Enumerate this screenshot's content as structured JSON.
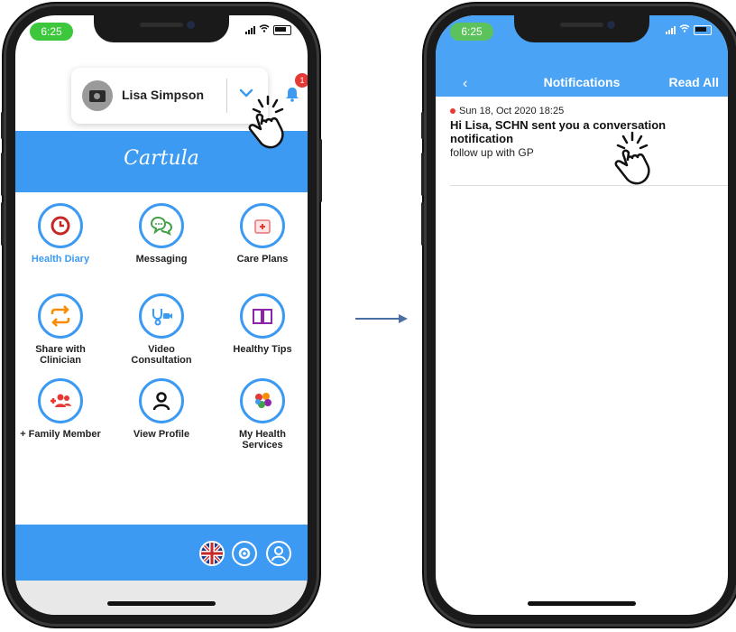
{
  "status": {
    "time": "6:25"
  },
  "home": {
    "user_name": "Lisa Simpson",
    "notification_count": "1",
    "brand": "Cartula",
    "tiles": [
      {
        "label": "Health Diary",
        "icon": "clock-icon",
        "color": "#c62828",
        "active": true
      },
      {
        "label": "Messaging",
        "icon": "chat-bubbles-icon",
        "color": "#43a047"
      },
      {
        "label": "Care Plans",
        "icon": "care-plan-icon",
        "color": "#e53935"
      },
      {
        "label": "Share with Clinician",
        "icon": "swap-arrows-icon",
        "color": "#fb8c00"
      },
      {
        "label": "Video Consultation",
        "icon": "stethoscope-video-icon",
        "color": "#3c9af2"
      },
      {
        "label": "Healthy Tips",
        "icon": "book-icon",
        "color": "#8e24aa"
      },
      {
        "label": "+ Family Member",
        "icon": "add-family-icon",
        "color": "#e53935"
      },
      {
        "label": "View Profile",
        "icon": "person-icon",
        "color": "#222222"
      },
      {
        "label": "My Health Services",
        "icon": "services-logo-icon",
        "color": "#3c9af2"
      }
    ],
    "bottom_icons": [
      "uk-flag-icon",
      "settings-gear-icon",
      "account-icon"
    ]
  },
  "notifications": {
    "back": "‹",
    "title": "Notifications",
    "read_all": "Read All",
    "items": [
      {
        "date": "Sun 18, Oct 2020 18:25",
        "title": "Hi Lisa, SCHN sent you a conversation notification",
        "body": "follow up with GP",
        "unread": true
      }
    ]
  },
  "colors": {
    "primary": "#3c9af2",
    "badge": "#e53935",
    "time_pill": "#3cc73c"
  }
}
